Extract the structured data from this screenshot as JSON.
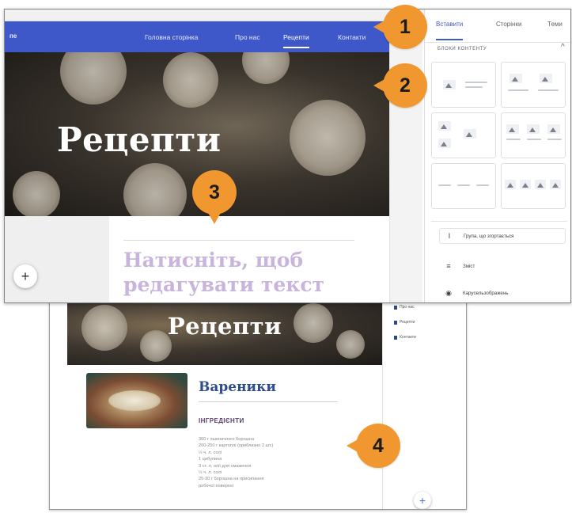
{
  "top_screenshot": {
    "brand": "пе",
    "nav": [
      "Головна сторінка",
      "Про нас",
      "Рецепти",
      "Контакти"
    ],
    "nav_active_index": 2,
    "hero_title": "Рецепти",
    "placeholder_text": "Натисніть, щоб редагувати текст",
    "add_button_symbol": "+",
    "panel": {
      "tabs": [
        "Вставити",
        "Сторінки",
        "Теми"
      ],
      "active_tab": "Вставити",
      "section_title": "БЛОКИ КОНТЕНТУ",
      "section_chevron": "^",
      "items": [
        {
          "icon": "Ⅰ",
          "label": "Група, що згортається"
        },
        {
          "icon": "≡",
          "label": "Зміст"
        },
        {
          "icon": "◉",
          "label": "Карусельзображень"
        }
      ]
    }
  },
  "bottom_screenshot": {
    "hero_title": "Рецепти",
    "dish_title": "Вареники",
    "ingredients_heading": "ІНГРЕДІЄНТИ",
    "ingredients": [
      "360 г пшеничного борошна",
      "200-250 г картоплі (приблизно 2 шт.)",
      "½ ч. л. солі",
      "1 цибулина",
      "3 ст. л. олії для смаження",
      "½ ч. л. солі",
      "25-30 г борошна на присипання",
      "робочої поверхні"
    ],
    "side_pages": [
      "Про нас",
      "Рецепти",
      "Контакти"
    ],
    "add_button_symbol": "+"
  },
  "badges": [
    "1",
    "2",
    "3",
    "4"
  ],
  "colors": {
    "nav_blue": "#3f58c9",
    "badge_orange": "#f0972f",
    "placeholder_purple": "#c9b4dc",
    "dish_title_blue": "#2e4d8a"
  }
}
